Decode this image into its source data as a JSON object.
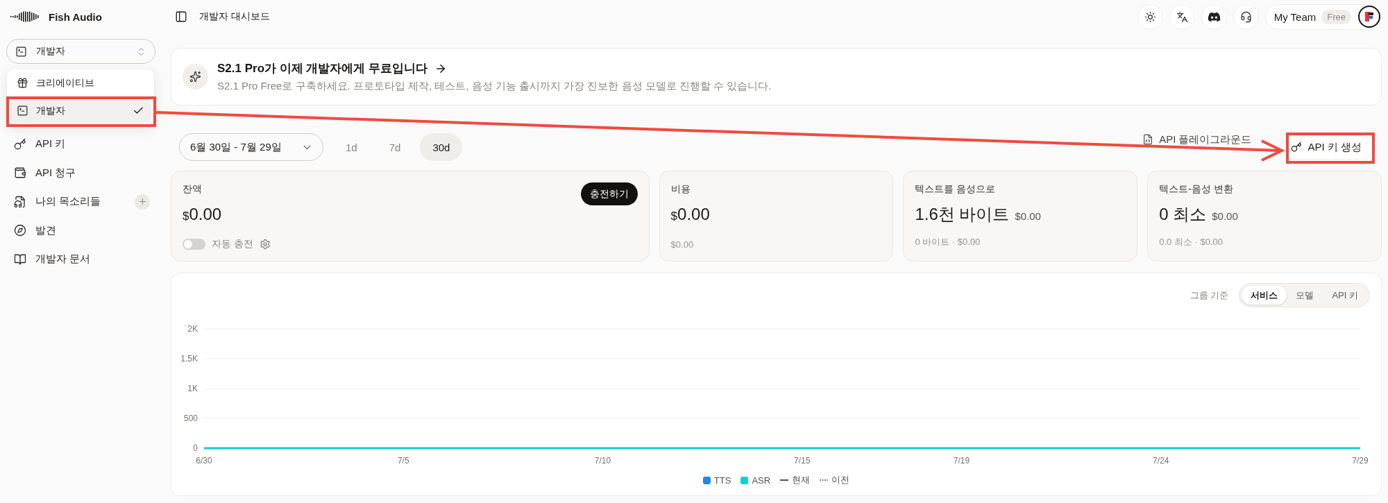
{
  "sidebar": {
    "brand": "Fish Audio",
    "workspace": {
      "label": "개발자",
      "kind": "developer"
    },
    "workspace_menu": [
      {
        "label": "크리에이티브",
        "kind": "creative",
        "selected": false
      },
      {
        "label": "개발자",
        "kind": "developer",
        "selected": true
      }
    ],
    "nav": [
      {
        "label": "API 키",
        "kind": "key",
        "addable": false
      },
      {
        "label": "API 청구",
        "kind": "billing",
        "addable": false
      },
      {
        "label": "나의 목소리들",
        "kind": "voices",
        "addable": true
      },
      {
        "label": "발견",
        "kind": "discover",
        "addable": false
      },
      {
        "label": "개발자 문서",
        "kind": "docs",
        "addable": false
      }
    ]
  },
  "topbar": {
    "title": "개발자 대시보드",
    "team": {
      "name": "My Team",
      "plan": "Free"
    }
  },
  "banner": {
    "title": "S2.1 Pro가 이제 개발자에게 무료입니다",
    "text": "S2.1 Pro Free로 구축하세요. 프로토타입 제작, 테스트, 음성 기능 출시까지 가장 진보한 음성 모델로 진행할 수 있습니다."
  },
  "toolbar": {
    "date_range": "6월 30일 - 7월 29일",
    "periods": [
      {
        "label": "1d",
        "selected": false
      },
      {
        "label": "7d",
        "selected": false
      },
      {
        "label": "30d",
        "selected": true
      }
    ],
    "actions": [
      {
        "label": "API 플레이그라운드",
        "kind": "link"
      },
      {
        "label": "API 키 생성",
        "kind": "button"
      }
    ]
  },
  "stats": [
    {
      "kind": "balance",
      "label": "잔액",
      "currency": "$",
      "amount": "0.00",
      "action": "충전하기",
      "auto_recharge": {
        "label": "자동 충전",
        "on": false
      }
    },
    {
      "kind": "spend",
      "label": "비용",
      "currency": "$",
      "amount": "0.00",
      "note": "$0.00"
    },
    {
      "kind": "usage",
      "label": "텍스트를 음성으로",
      "amount": "1.6천 바이트",
      "cost": "$0.00",
      "note": "0 바이트 · $0.00"
    },
    {
      "kind": "usage",
      "label": "텍스트-음성 변환",
      "amount": "0 최소",
      "cost": "$0.00",
      "note": "0.0 최소 · $0.00"
    }
  ],
  "usage_chart": {
    "group_by": {
      "label": "그룹 기준",
      "options": [
        {
          "label": "서비스",
          "selected": true
        },
        {
          "label": "모델",
          "selected": false
        },
        {
          "label": "API 키",
          "selected": false
        }
      ]
    },
    "chart_data": {
      "type": "line",
      "categories": [
        "6/30",
        null,
        null,
        null,
        null,
        "7/5",
        null,
        null,
        null,
        null,
        "7/10",
        null,
        null,
        null,
        null,
        "7/15",
        null,
        null,
        null,
        "7/19",
        null,
        null,
        null,
        null,
        "7/24",
        null,
        null,
        null,
        null,
        "7/29"
      ],
      "series": [
        {
          "name": "TTS",
          "color": "#1f88e8",
          "values": [
            null,
            null,
            null,
            null,
            null,
            null,
            null,
            null,
            null,
            null,
            null,
            null,
            null,
            null,
            null,
            null,
            null,
            null,
            null,
            null,
            null,
            null,
            null,
            null,
            null,
            null,
            null,
            null,
            null,
            null
          ]
        },
        {
          "name": "ASR",
          "color": "#14cfc9",
          "values": [
            0,
            0,
            0,
            0,
            0,
            0,
            0,
            0,
            0,
            0,
            0,
            0,
            0,
            0,
            0,
            0,
            0,
            0,
            0,
            0,
            0,
            0,
            0,
            0,
            0,
            0,
            0,
            0,
            0,
            0
          ]
        }
      ],
      "ylim": [
        0,
        2000
      ],
      "yticks": [
        0,
        500,
        {
          "value": 1000,
          "label": "1K"
        },
        {
          "value": 1500,
          "label": "1.5K"
        },
        {
          "value": 2000,
          "label": "2K"
        }
      ],
      "grid": true
    },
    "line_styles": [
      {
        "label": "현재",
        "kind": "solid"
      },
      {
        "label": "이전",
        "kind": "dashed"
      }
    ]
  },
  "annotations": [
    {
      "kind": "frame"
    },
    {
      "kind": "arrow"
    },
    {
      "kind": "frame"
    }
  ]
}
